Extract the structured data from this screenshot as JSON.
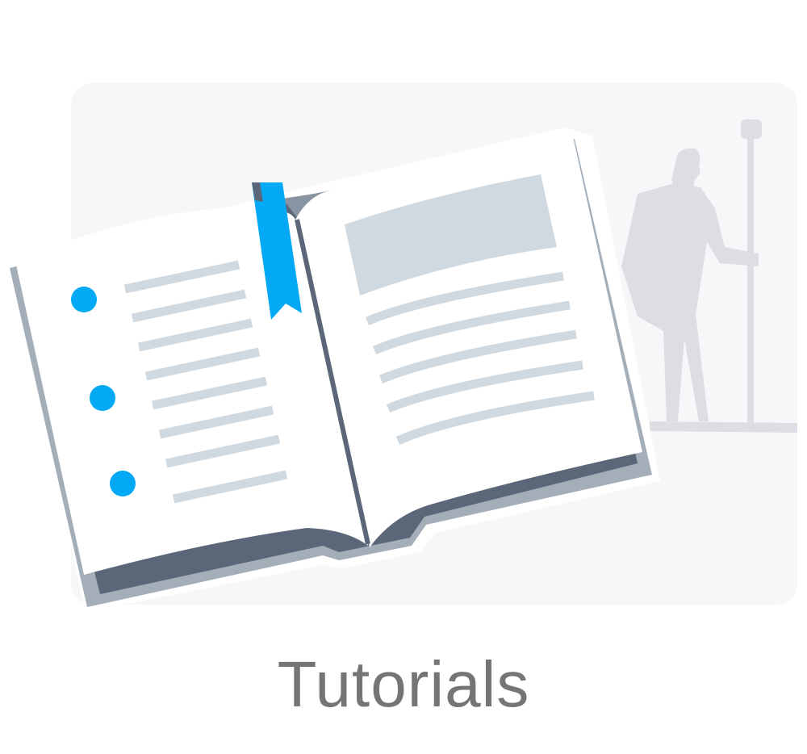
{
  "caption": {
    "text": "Tutorials"
  },
  "illustration": {
    "icon": "open-book-icon",
    "background_panel_color": "#f6f7f9",
    "figure_color": "#dcdee3",
    "book_cover_color": "#5b6779",
    "book_edge_color": "#a3aeb8",
    "page_color": "#ffffff",
    "text_line_color": "#d1d9e0",
    "bookmark_color": "#03a9f4",
    "bullet_color": "#03a9f4"
  }
}
